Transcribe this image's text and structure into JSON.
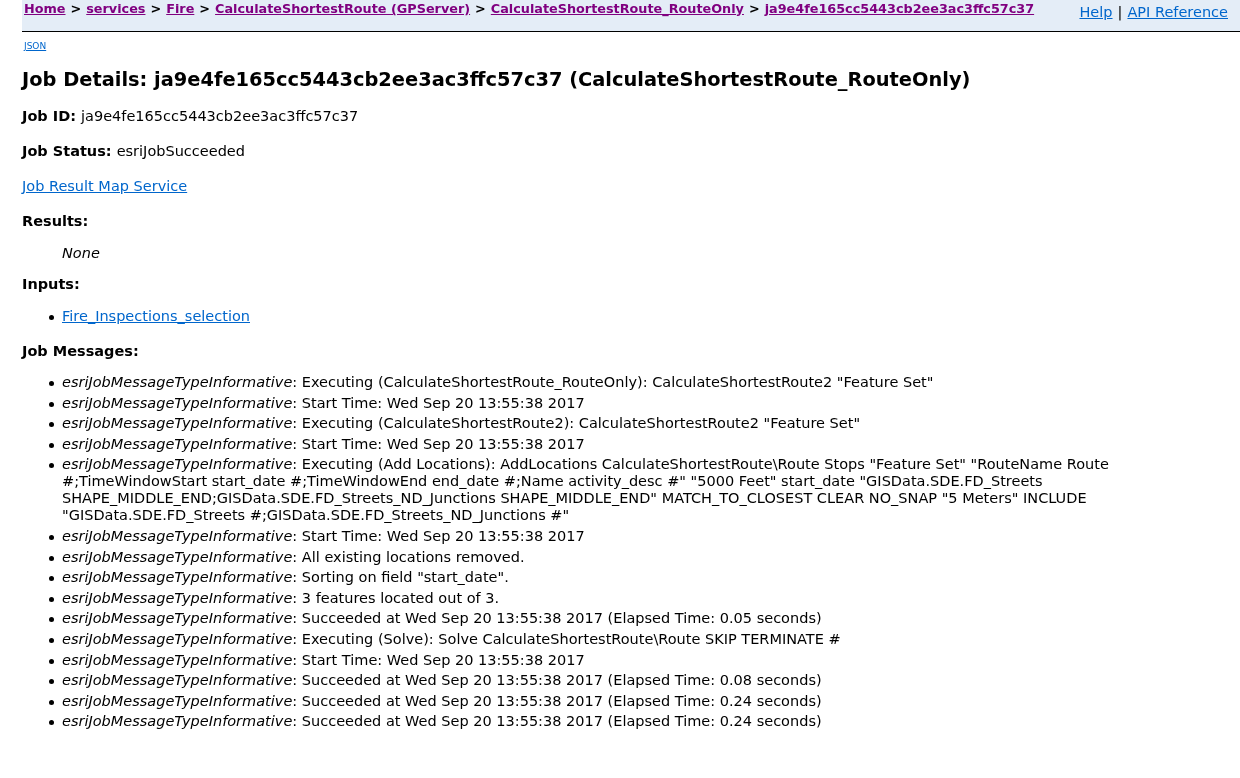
{
  "header": {
    "breadcrumb": [
      {
        "kind": "link",
        "text": "Home"
      },
      {
        "kind": "separator",
        "text": ">"
      },
      {
        "kind": "link",
        "text": "services"
      },
      {
        "kind": "separator",
        "text": ">"
      },
      {
        "kind": "link",
        "text": "Fire"
      },
      {
        "kind": "separator",
        "text": ">"
      },
      {
        "kind": "link",
        "text": "CalculateShortestRoute (GPServer)"
      },
      {
        "kind": "separator",
        "text": ">"
      },
      {
        "kind": "link",
        "text": "CalculateShortestRoute_RouteOnly"
      },
      {
        "kind": "separator",
        "text": ">"
      },
      {
        "kind": "link",
        "text": "ja9e4fe165cc5443cb2ee3ac3ffc57c37"
      }
    ],
    "links": [
      {
        "kind": "link",
        "text": "Help"
      },
      {
        "kind": "separator",
        "text": "|"
      },
      {
        "kind": "link",
        "text": "API Reference"
      }
    ]
  },
  "format_link": "JSON",
  "title": "Job Details: ja9e4fe165cc5443cb2ee3ac3ffc57c37 (CalculateShortestRoute_RouteOnly)",
  "fields": [
    {
      "label": "Job ID:",
      "value": "ja9e4fe165cc5443cb2ee3ac3ffc57c37"
    },
    {
      "label": "Job Status:",
      "value": "esriJobSucceeded"
    }
  ],
  "result_link": "Job Result Map Service",
  "results": {
    "heading": "Results:",
    "empty_text": "None"
  },
  "inputs": {
    "heading": "Inputs:",
    "items": [
      "Fire_Inspections_selection"
    ]
  },
  "job_messages": {
    "heading": "Job Messages:",
    "items": [
      "*esriJobMessageTypeInformative*: Executing (CalculateShortestRoute_RouteOnly): CalculateShortestRoute2 \"Feature Set\"",
      "*esriJobMessageTypeInformative*: Start Time: Wed Sep 20 13:55:38 2017",
      "*esriJobMessageTypeInformative*: Executing (CalculateShortestRoute2): CalculateShortestRoute2 \"Feature Set\"",
      "*esriJobMessageTypeInformative*: Start Time: Wed Sep 20 13:55:38 2017",
      "*esriJobMessageTypeInformative*: Executing (Add Locations): AddLocations CalculateShortestRoute\\Route Stops \"Feature Set\" \"RouteName Route #;TimeWindowStart start_date #;TimeWindowEnd end_date #;Name activity_desc #\" \"5000 Feet\" start_date \"GISData.SDE.FD_Streets SHAPE_MIDDLE_END;GISData.SDE.FD_Streets_ND_Junctions SHAPE_MIDDLE_END\" MATCH_TO_CLOSEST CLEAR NO_SNAP \"5 Meters\" INCLUDE \"GISData.SDE.FD_Streets #;GISData.SDE.FD_Streets_ND_Junctions #\"",
      "*esriJobMessageTypeInformative*: Start Time: Wed Sep 20 13:55:38 2017",
      "*esriJobMessageTypeInformative*: All existing locations removed.",
      "*esriJobMessageTypeInformative*: Sorting on field \"start_date\".",
      "*esriJobMessageTypeInformative*: 3 features located out of 3.",
      "*esriJobMessageTypeInformative*: Succeeded at Wed Sep 20 13:55:38 2017 (Elapsed Time: 0.05 seconds)",
      "*esriJobMessageTypeInformative*: Executing (Solve): Solve CalculateShortestRoute\\Route SKIP TERMINATE #",
      "*esriJobMessageTypeInformative*: Start Time: Wed Sep 20 13:55:38 2017",
      "*esriJobMessageTypeInformative*: Succeeded at Wed Sep 20 13:55:38 2017 (Elapsed Time: 0.08 seconds)",
      "*esriJobMessageTypeInformative*: Succeeded at Wed Sep 20 13:55:38 2017 (Elapsed Time: 0.24 seconds)",
      "*esriJobMessageTypeInformative*: Succeeded at Wed Sep 20 13:55:38 2017 (Elapsed Time: 0.24 seconds)"
    ]
  }
}
